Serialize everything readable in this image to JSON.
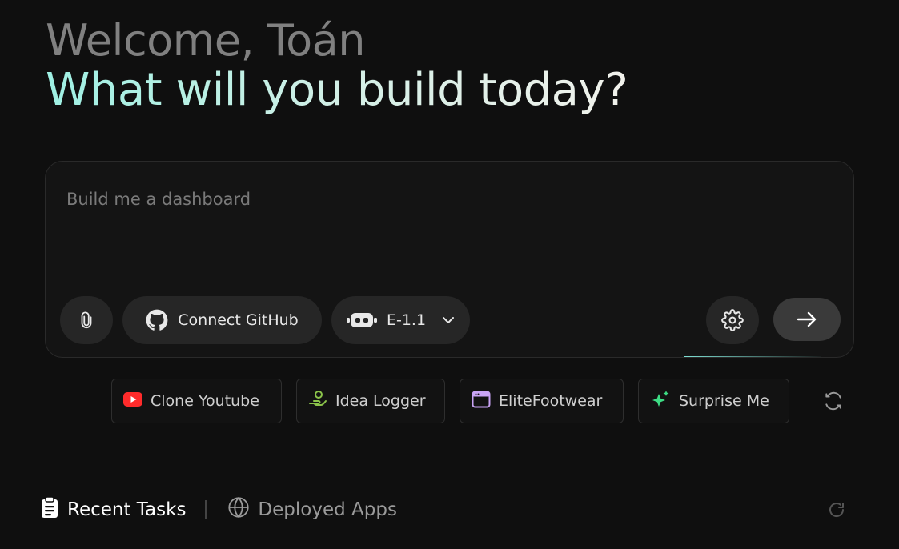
{
  "header": {
    "welcome": "Welcome, Toán",
    "headline": "What will you build today?"
  },
  "composer": {
    "placeholder": "Build me a dashboard",
    "value": "",
    "attach_icon": "paperclip-icon",
    "github_label": "Connect GitHub",
    "github_icon": "github-icon",
    "model_label": "E-1.1",
    "model_icon": "robot-icon",
    "settings_icon": "gear-icon",
    "send_icon": "arrow-right-icon"
  },
  "suggestions": [
    {
      "label": "Clone Youtube",
      "icon": "youtube-icon",
      "color": "#ff2b2b"
    },
    {
      "label": "Idea Logger",
      "icon": "idea-hand-icon",
      "color": "#8bc34a"
    },
    {
      "label": "EliteFootwear",
      "icon": "browser-window-icon",
      "color": "#c9a4f5"
    },
    {
      "label": "Surprise Me",
      "icon": "sparkle-icon",
      "color": "#3ddc84"
    }
  ],
  "tabs": [
    {
      "label": "Recent Tasks",
      "icon": "clipboard-icon",
      "active": true
    },
    {
      "label": "Deployed Apps",
      "icon": "globe-icon",
      "active": false
    }
  ],
  "colors": {
    "background": "#0f0f0f",
    "headline_gradient_start": "#9ef0e3",
    "headline_gradient_end": "#f2f2ec",
    "composer_bg": "#141414",
    "pill_bg": "#262626"
  }
}
